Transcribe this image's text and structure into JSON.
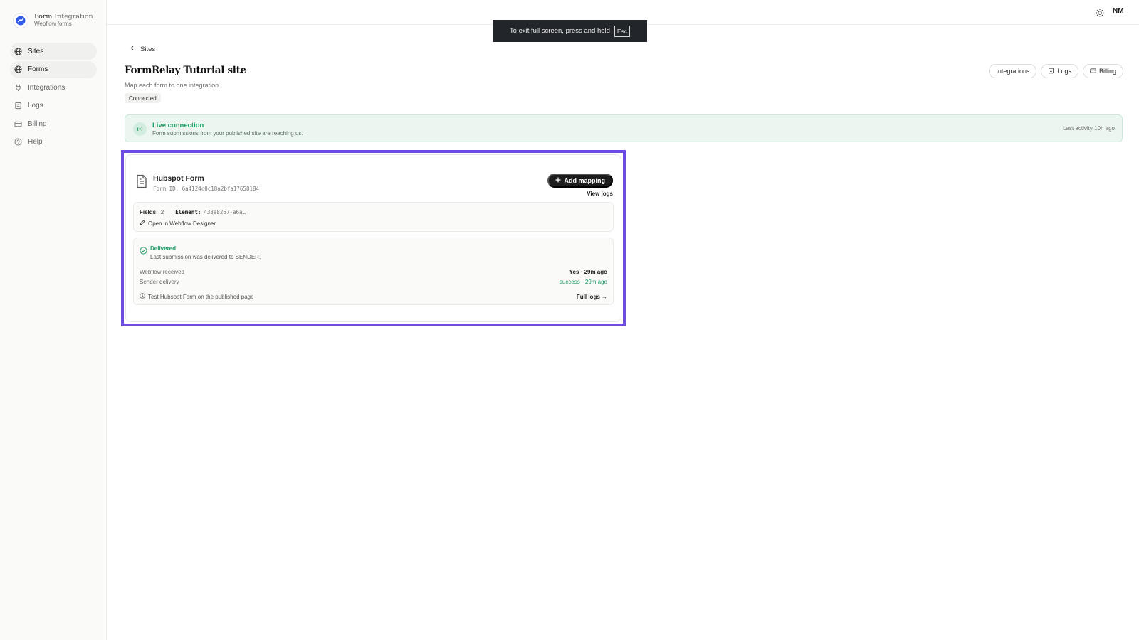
{
  "brand": {
    "name_main": "Form",
    "name_light": "Integration",
    "subtitle": "Webflow forms"
  },
  "sidebar": {
    "items": [
      {
        "label": "Sites",
        "icon": "globe-icon",
        "active": true
      },
      {
        "label": "Forms",
        "icon": "globe-icon",
        "active": true
      },
      {
        "label": "Integrations",
        "icon": "plug-icon",
        "active": false
      },
      {
        "label": "Logs",
        "icon": "scroll-icon",
        "active": false
      },
      {
        "label": "Billing",
        "icon": "card-icon",
        "active": false
      },
      {
        "label": "Help",
        "icon": "help-icon",
        "active": false
      }
    ]
  },
  "topbar": {
    "avatar": "NM",
    "theme_icon": "sun-icon"
  },
  "toast": {
    "text": "To exit full screen, press and hold",
    "key": "Esc"
  },
  "page": {
    "back_label": "Sites",
    "title": "FormRelay Tutorial site",
    "subtitle": "Map each form to one integration.",
    "status": "Connected",
    "actions": [
      {
        "label": "Integrations"
      },
      {
        "label": "Logs"
      },
      {
        "label": "Billing"
      }
    ]
  },
  "live": {
    "title": "Live connection",
    "description": "Form submissions from your published site are reaching us.",
    "activity": "Last activity 10h ago"
  },
  "form_card": {
    "title": "Hubspot Form",
    "form_id": "Form ID: 6a4124c0c18a2bfa17658184",
    "add_button": "Add mapping",
    "view_logs": "View logs",
    "fields_label": "Fields:",
    "fields_value": "2",
    "element_label": "Element:",
    "element_value": "433a8257-a6a…",
    "open_designer": "Open in Webflow Designer",
    "status_title": "Delivered",
    "status_desc": "Last submission was delivered to SENDER.",
    "webflow_label": "Webflow received",
    "webflow_value": "Yes · 29m ago",
    "sender_label": "Sender delivery",
    "sender_value": "success · 29m ago",
    "test_label": "Test Hubspot Form on the published page",
    "full_logs": "Full logs →"
  },
  "colors": {
    "accent_green": "#1f9b63",
    "highlight": "#6f4ce0",
    "dark_button": "#1c1c1c"
  }
}
